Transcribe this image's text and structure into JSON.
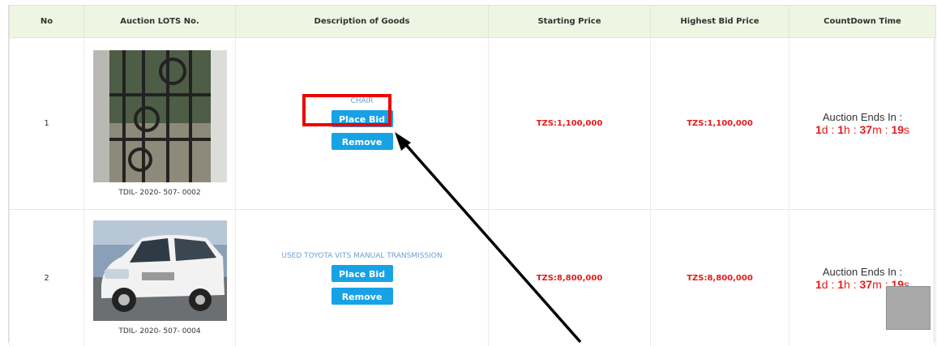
{
  "headers": {
    "no": "No",
    "lot": "Auction LOTS No.",
    "desc": "Description of Goods",
    "start": "Starting Price",
    "highest": "Highest Bid Price",
    "countdown": "CountDown Time"
  },
  "rows": [
    {
      "no": "1",
      "lot_code": "TDIL- 2020- 507- 0002",
      "image_icon": "window-grill-photo",
      "description": "CHAIR",
      "place_bid": "Place Bid",
      "remove": "Remove",
      "starting_price": "TZS:1,100,000",
      "highest_bid": "TZS:1,100,000",
      "countdown_label": "Auction Ends In :",
      "d": "1",
      "h": "1",
      "m": "37",
      "s": "19"
    },
    {
      "no": "2",
      "lot_code": "TDIL- 2020- 507- 0004",
      "image_icon": "white-suv-photo",
      "description": "USED TOYOTA VITS MANUAL TRANSMISSION",
      "place_bid": "Place Bid",
      "remove": "Remove",
      "starting_price": "TZS:8,800,000",
      "highest_bid": "TZS:8,800,000",
      "countdown_label": "Auction Ends In :",
      "d": "1",
      "h": "1",
      "m": "37",
      "s": "19"
    }
  ],
  "units": {
    "d": "d",
    "h": "h",
    "m": "m",
    "s": "s",
    "sep": " : "
  },
  "colors": {
    "accent": "#18a2e6",
    "price": "#e51b1b",
    "header_bg": "#eef6e3",
    "annotation": "#ee0000"
  }
}
